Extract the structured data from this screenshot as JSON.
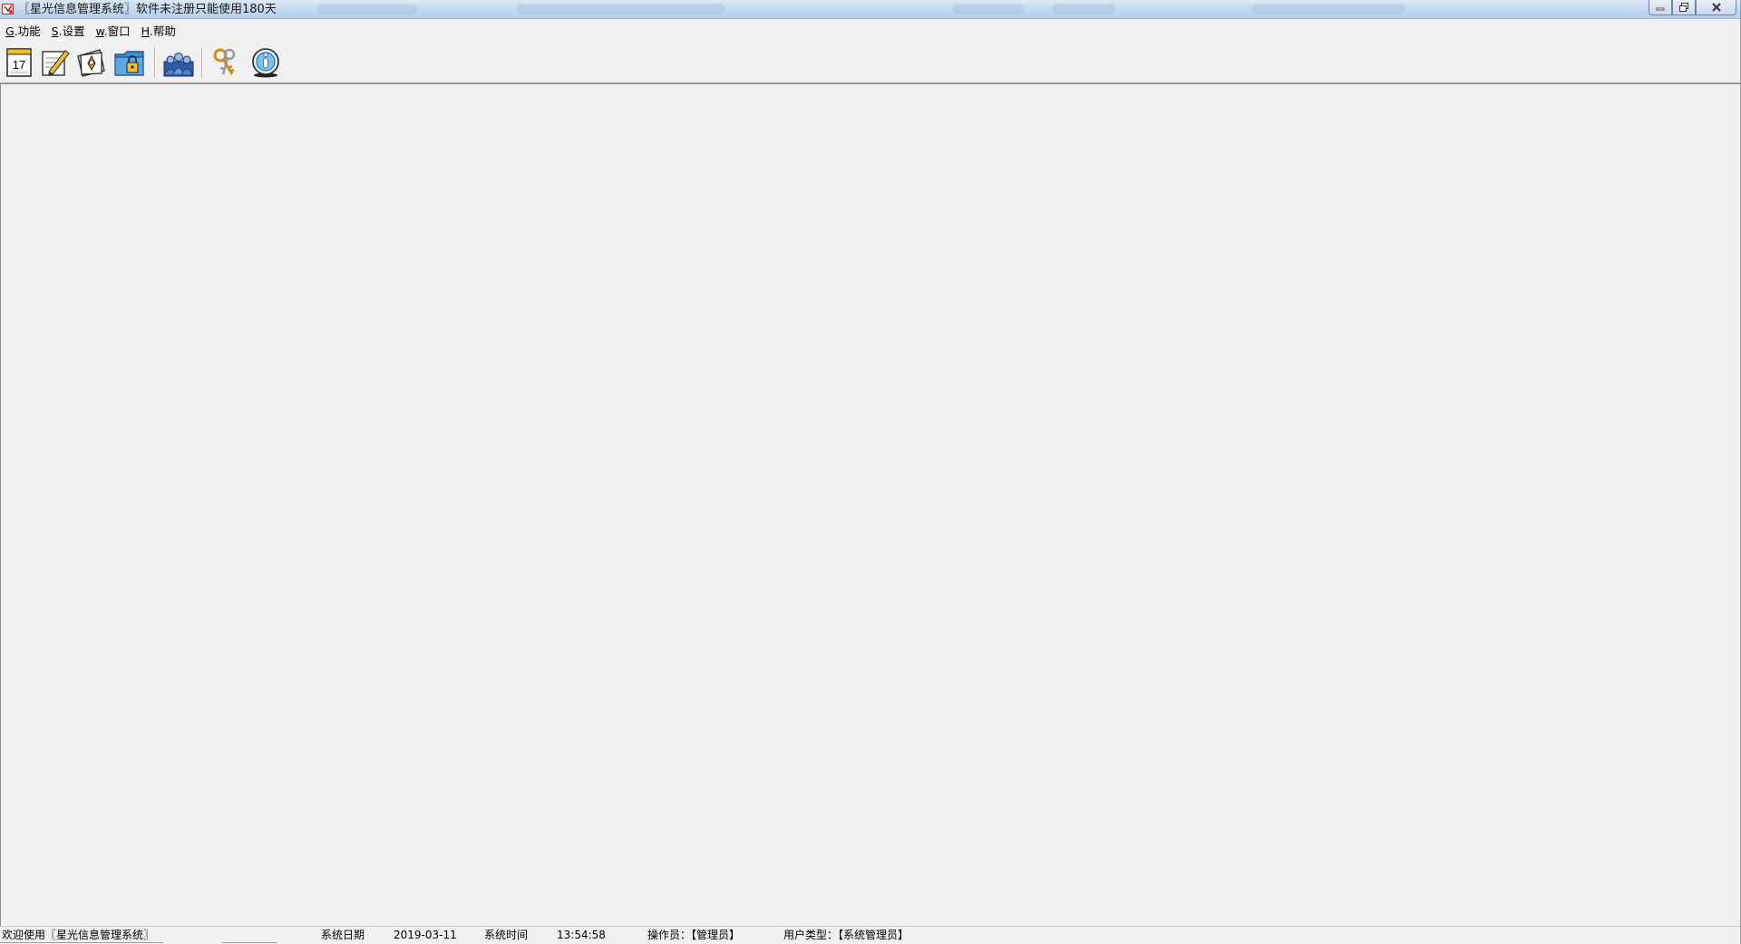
{
  "window": {
    "title": "〖星光信息管理系统〗软件未注册只能使用180天"
  },
  "menubar": {
    "items": [
      {
        "key": "G",
        "label": ".功能"
      },
      {
        "key": "S",
        "label": ".设置"
      },
      {
        "key": "w",
        "label": ".窗口"
      },
      {
        "key": "H",
        "label": ".帮助"
      }
    ]
  },
  "toolbar": {
    "calendar_day": "17",
    "buttons": [
      {
        "icon": "calendar-icon"
      },
      {
        "icon": "notepad-pencil-icon"
      },
      {
        "icon": "address-card-icon"
      },
      {
        "icon": "locked-folder-icon"
      },
      {
        "icon": "users-group-icon"
      },
      {
        "icon": "keys-icon"
      },
      {
        "icon": "info-globe-icon"
      }
    ]
  },
  "statusbar": {
    "welcome": "欢迎使用〖星光信息管理系统〗",
    "date_label": "系统日期",
    "date_value": "2019-03-11",
    "time_label": "系统时间",
    "time_value": "13:54:58",
    "operator": "操作员：【管理员】",
    "user_type": "用户类型：【系统管理员】"
  },
  "colors": {
    "titlebar": "#c5d9ef",
    "background": "#f0f0f0"
  }
}
